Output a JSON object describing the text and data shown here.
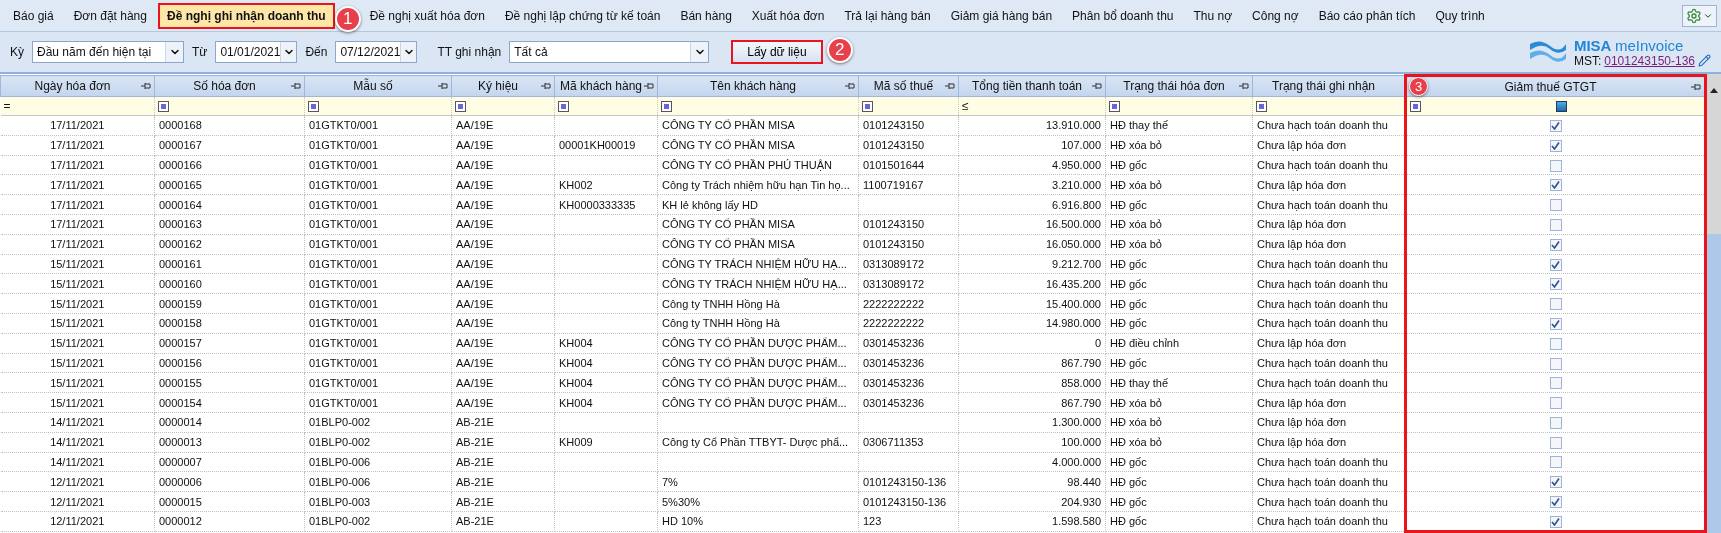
{
  "menu": [
    {
      "label": "Báo giá",
      "selected": false
    },
    {
      "label": "Đơn đặt hàng",
      "selected": false
    },
    {
      "label": "Đề nghị ghi nhận doanh thu",
      "selected": true,
      "callout": "1"
    },
    {
      "label": "Đề nghị xuất hóa đơn",
      "selected": false
    },
    {
      "label": "Đề nghị lập chứng từ kế toán",
      "selected": false
    },
    {
      "label": "Bán hàng",
      "selected": false
    },
    {
      "label": "Xuất hóa đơn",
      "selected": false
    },
    {
      "label": "Trả lại hàng bán",
      "selected": false
    },
    {
      "label": "Giảm giá hàng bán",
      "selected": false
    },
    {
      "label": "Phân bổ doanh thu",
      "selected": false
    },
    {
      "label": "Thu nợ",
      "selected": false
    },
    {
      "label": "Công nợ",
      "selected": false
    },
    {
      "label": "Báo cáo phân tích",
      "selected": false
    },
    {
      "label": "Quy trình",
      "selected": false
    }
  ],
  "filters": {
    "period": {
      "label": "Kỳ",
      "value": "Đầu năm đến hiện tại"
    },
    "from": {
      "label": "Từ",
      "value": "01/01/2021"
    },
    "to": {
      "label": "Đến",
      "value": "07/12/2021"
    },
    "status": {
      "label": "TT ghi nhận",
      "value": "Tất cả"
    },
    "button": {
      "label": "Lấy dữ liệu",
      "callout": "2"
    }
  },
  "brand": {
    "name": "MISA",
    "product": "meInvoice",
    "tax_label": "MST:",
    "tax_id": "0101243150-136"
  },
  "table": {
    "columns": [
      {
        "title": "Ngày hóa đơn",
        "kind": "date",
        "pin": true,
        "filter": "="
      },
      {
        "title": "Số hóa đơn",
        "kind": "text",
        "pin": true
      },
      {
        "title": "Mẫu số",
        "kind": "text",
        "pin": true
      },
      {
        "title": "Ký hiệu",
        "kind": "text",
        "pin": true
      },
      {
        "title": "Mã khách hàng",
        "kind": "text",
        "pin": true
      },
      {
        "title": "Tên khách hàng",
        "kind": "text",
        "pin": true
      },
      {
        "title": "Mã số thuế",
        "kind": "text",
        "pin": true
      },
      {
        "title": "Tổng tiền thanh toán",
        "kind": "amount",
        "pin": true,
        "filter": "≤"
      },
      {
        "title": "Trạng thái hóa đơn",
        "kind": "text",
        "pin": true
      },
      {
        "title": "Trạng thái ghi nhận",
        "kind": "text",
        "pin": false
      },
      {
        "title": "Giảm thuế GTGT",
        "kind": "check",
        "pin": true,
        "callout": "3"
      }
    ],
    "rows": [
      {
        "cells": [
          "17/11/2021",
          "0000168",
          "01GTKT0/001",
          "AA/19E",
          "",
          "CÔNG TY CỔ PHẦN MISA",
          "0101243150",
          "13.910.000",
          "HĐ thay thế",
          "Chưa hạch toán doanh thu"
        ],
        "checked": true
      },
      {
        "cells": [
          "17/11/2021",
          "0000167",
          "01GTKT0/001",
          "AA/19E",
          "00001KH00019",
          "CÔNG TY CỔ PHẦN MISA",
          "0101243150",
          "107.000",
          "HĐ xóa bỏ",
          "Chưa lập hóa đơn"
        ],
        "checked": true
      },
      {
        "cells": [
          "17/11/2021",
          "0000166",
          "01GTKT0/001",
          "AA/19E",
          "",
          "CÔNG TY CỔ PHẦN PHÚ THUẬN",
          "0101501644",
          "4.950.000",
          "HĐ gốc",
          "Chưa hạch toán doanh thu"
        ],
        "checked": false
      },
      {
        "cells": [
          "17/11/2021",
          "0000165",
          "01GTKT0/001",
          "AA/19E",
          "KH002",
          "Công ty Trách nhiệm hữu hạn Tin họ...",
          "1100719167",
          "3.210.000",
          "HĐ xóa bỏ",
          "Chưa lập hóa đơn"
        ],
        "checked": true
      },
      {
        "cells": [
          "17/11/2021",
          "0000164",
          "01GTKT0/001",
          "AA/19E",
          "KH0000333335",
          "KH lẻ không lấy HD",
          "",
          "6.916.800",
          "HĐ gốc",
          "Chưa hạch toán doanh thu"
        ],
        "checked": false
      },
      {
        "cells": [
          "17/11/2021",
          "0000163",
          "01GTKT0/001",
          "AA/19E",
          "",
          "CÔNG TY CỔ PHẦN MISA",
          "0101243150",
          "16.500.000",
          "HĐ xóa bỏ",
          "Chưa lập hóa đơn"
        ],
        "checked": false
      },
      {
        "cells": [
          "17/11/2021",
          "0000162",
          "01GTKT0/001",
          "AA/19E",
          "",
          "CÔNG TY CỔ PHẦN MISA",
          "0101243150",
          "16.050.000",
          "HĐ xóa bỏ",
          "Chưa lập hóa đơn"
        ],
        "checked": true
      },
      {
        "cells": [
          "15/11/2021",
          "0000161",
          "01GTKT0/001",
          "AA/19E",
          "",
          "CÔNG TY TRÁCH NHIỆM HỮU HẠ...",
          "0313089172",
          "9.212.700",
          "HĐ gốc",
          "Chưa hạch toán doanh thu"
        ],
        "checked": true
      },
      {
        "cells": [
          "15/11/2021",
          "0000160",
          "01GTKT0/001",
          "AA/19E",
          "",
          "CÔNG TY TRÁCH NHIỆM HỮU HẠ...",
          "0313089172",
          "16.435.200",
          "HĐ gốc",
          "Chưa hạch toán doanh thu"
        ],
        "checked": true
      },
      {
        "cells": [
          "15/11/2021",
          "0000159",
          "01GTKT0/001",
          "AA/19E",
          "",
          "Công ty TNHH Hồng Hà",
          "2222222222",
          "15.400.000",
          "HĐ gốc",
          "Chưa hạch toán doanh thu"
        ],
        "checked": false
      },
      {
        "cells": [
          "15/11/2021",
          "0000158",
          "01GTKT0/001",
          "AA/19E",
          "",
          "Công ty TNHH Hồng Hà",
          "2222222222",
          "14.980.000",
          "HĐ gốc",
          "Chưa hạch toán doanh thu"
        ],
        "checked": true
      },
      {
        "cells": [
          "15/11/2021",
          "0000157",
          "01GTKT0/001",
          "AA/19E",
          "KH004",
          "CÔNG TY CỔ PHẦN DƯỢC PHẨM...",
          "0301453236",
          "0",
          "HĐ điều chỉnh",
          "Chưa lập hóa đơn"
        ],
        "checked": false
      },
      {
        "cells": [
          "15/11/2021",
          "0000156",
          "01GTKT0/001",
          "AA/19E",
          "KH004",
          "CÔNG TY CỔ PHẦN DƯỢC PHẨM...",
          "0301453236",
          "867.790",
          "HĐ gốc",
          "Chưa hạch toán doanh thu"
        ],
        "checked": false
      },
      {
        "cells": [
          "15/11/2021",
          "0000155",
          "01GTKT0/001",
          "AA/19E",
          "KH004",
          "CÔNG TY CỔ PHẦN DƯỢC PHẨM...",
          "0301453236",
          "858.000",
          "HĐ thay thế",
          "Chưa hạch toán doanh thu"
        ],
        "checked": false
      },
      {
        "cells": [
          "15/11/2021",
          "0000154",
          "01GTKT0/001",
          "AA/19E",
          "KH004",
          "CÔNG TY CỔ PHẦN DƯỢC PHẨM...",
          "0301453236",
          "867.790",
          "HĐ xóa bỏ",
          "Chưa lập hóa đơn"
        ],
        "checked": false
      },
      {
        "cells": [
          "14/11/2021",
          "0000014",
          "01BLP0-002",
          "AB-21E",
          "",
          "",
          "",
          "1.300.000",
          "HĐ xóa bỏ",
          "Chưa lập hóa đơn"
        ],
        "checked": false
      },
      {
        "cells": [
          "14/11/2021",
          "0000013",
          "01BLP0-002",
          "AB-21E",
          "KH009",
          "Công ty Cổ Phần TTBYT- Dược phẩ...",
          "0306711353",
          "100.000",
          "HĐ xóa bỏ",
          "Chưa lập hóa đơn"
        ],
        "checked": false
      },
      {
        "cells": [
          "14/11/2021",
          "0000007",
          "01BLP0-006",
          "AB-21E",
          "",
          "",
          "",
          "4.000.000",
          "HĐ gốc",
          "Chưa hạch toán doanh thu"
        ],
        "checked": false
      },
      {
        "cells": [
          "12/11/2021",
          "0000006",
          "01BLP0-006",
          "AB-21E",
          "",
          "7%",
          "0101243150-136",
          "98.440",
          "HĐ gốc",
          "Chưa hạch toán doanh thu"
        ],
        "checked": true
      },
      {
        "cells": [
          "12/11/2021",
          "0000015",
          "01BLP0-003",
          "AB-21E",
          "",
          "5%30%",
          "0101243150-136",
          "204.930",
          "HĐ gốc",
          "Chưa hạch toán doanh thu"
        ],
        "checked": true
      },
      {
        "cells": [
          "12/11/2021",
          "0000012",
          "01BLP0-002",
          "AB-21E",
          "",
          "HD 10%",
          "123",
          "1.598.580",
          "HĐ gốc",
          "Chưa hạch toán doanh thu"
        ],
        "checked": true
      }
    ]
  }
}
